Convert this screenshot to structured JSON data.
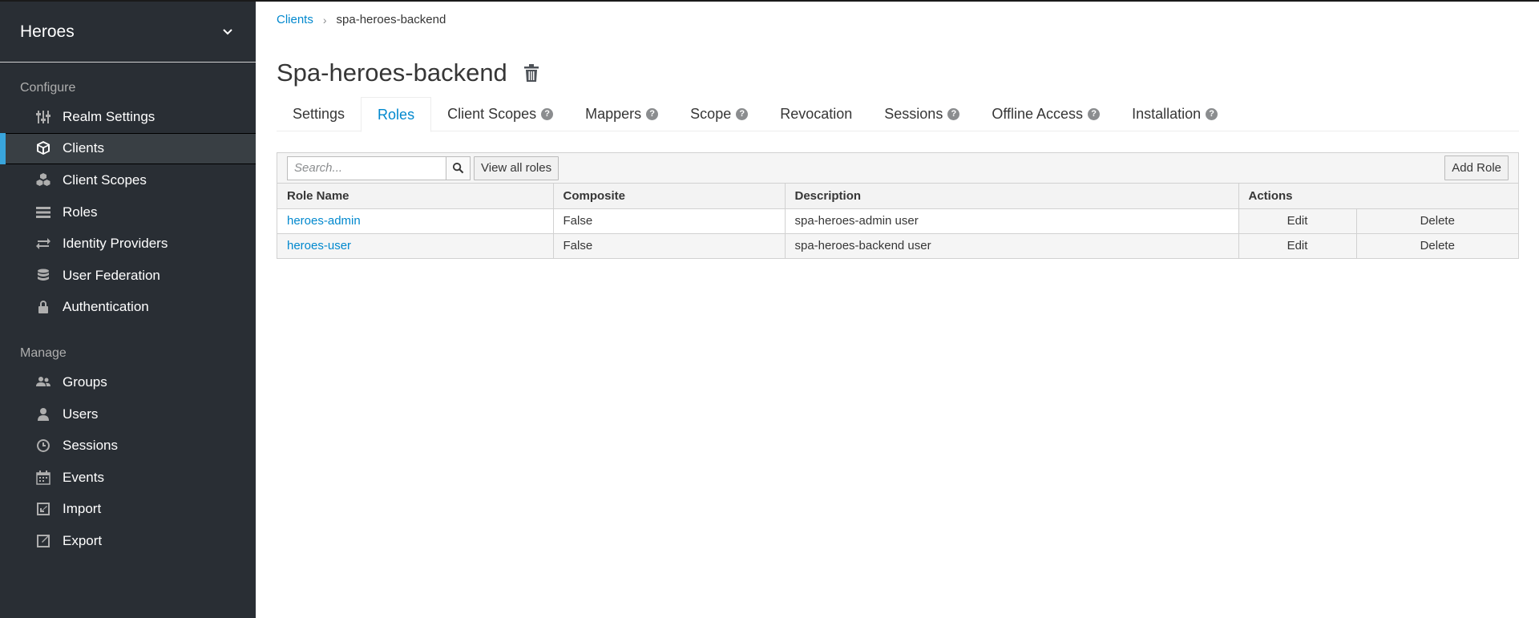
{
  "realm": {
    "name": "Heroes"
  },
  "sidebar": {
    "configure_title": "Configure",
    "manage_title": "Manage",
    "configure_items": [
      {
        "label": "Realm Settings",
        "icon": "sliders-icon"
      },
      {
        "label": "Clients",
        "icon": "cube-icon",
        "active": true
      },
      {
        "label": "Client Scopes",
        "icon": "cubes-icon"
      },
      {
        "label": "Roles",
        "icon": "list-icon"
      },
      {
        "label": "Identity Providers",
        "icon": "exchange-icon"
      },
      {
        "label": "User Federation",
        "icon": "database-icon"
      },
      {
        "label": "Authentication",
        "icon": "lock-icon"
      }
    ],
    "manage_items": [
      {
        "label": "Groups",
        "icon": "users-icon"
      },
      {
        "label": "Users",
        "icon": "user-icon"
      },
      {
        "label": "Sessions",
        "icon": "clock-icon"
      },
      {
        "label": "Events",
        "icon": "calendar-icon"
      },
      {
        "label": "Import",
        "icon": "import-icon"
      },
      {
        "label": "Export",
        "icon": "export-icon"
      }
    ]
  },
  "breadcrumb": {
    "parent": "Clients",
    "current": "spa-heroes-backend"
  },
  "page": {
    "title": "Spa-heroes-backend"
  },
  "tabs": [
    {
      "label": "Settings",
      "help": false
    },
    {
      "label": "Roles",
      "help": false,
      "active": true
    },
    {
      "label": "Client Scopes",
      "help": true
    },
    {
      "label": "Mappers",
      "help": true
    },
    {
      "label": "Scope",
      "help": true
    },
    {
      "label": "Revocation",
      "help": false
    },
    {
      "label": "Sessions",
      "help": true
    },
    {
      "label": "Offline Access",
      "help": true
    },
    {
      "label": "Installation",
      "help": true
    }
  ],
  "toolbar": {
    "search_placeholder": "Search...",
    "view_all_label": "View all roles",
    "add_role_label": "Add Role"
  },
  "table": {
    "columns": [
      "Role Name",
      "Composite",
      "Description",
      "Actions"
    ],
    "rows": [
      {
        "name": "heroes-admin",
        "composite": "False",
        "description": "spa-heroes-admin user",
        "edit": "Edit",
        "delete": "Delete"
      },
      {
        "name": "heroes-user",
        "composite": "False",
        "description": "spa-heroes-backend user",
        "edit": "Edit",
        "delete": "Delete"
      }
    ]
  },
  "colors": {
    "sidebar_bg": "#292e34",
    "accent": "#39a5dc",
    "link": "#0088ce"
  }
}
